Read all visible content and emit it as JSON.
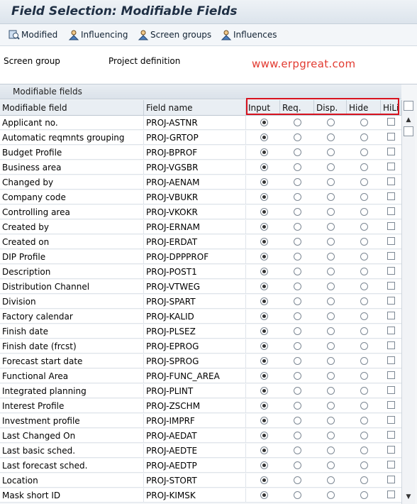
{
  "title": "Field Selection: Modifiable Fields",
  "toolbar": {
    "modified": "Modified",
    "influencing": "Influencing",
    "screen_groups": "Screen groups",
    "influences": "Influences"
  },
  "info": {
    "screen_group_label": "Screen group",
    "screen_group_value": "Project definition",
    "watermark": "www.erpgreat.com"
  },
  "grid": {
    "title": "Modifiable fields",
    "columns": {
      "modifiable_field": "Modifiable field",
      "field_name": "Field name",
      "input": "Input",
      "req": "Req.",
      "disp": "Disp.",
      "hide": "Hide",
      "hili": "HiLi"
    },
    "rows": [
      {
        "field": "Applicant no.",
        "name": "PROJ-ASTNR",
        "selected": "Input",
        "hili": false
      },
      {
        "field": "Automatic reqmnts grouping",
        "name": "PROJ-GRTOP",
        "selected": "Input",
        "hili": false
      },
      {
        "field": "Budget Profile",
        "name": "PROJ-BPROF",
        "selected": "Input",
        "hili": false
      },
      {
        "field": "Business area",
        "name": "PROJ-VGSBR",
        "selected": "Input",
        "hili": false
      },
      {
        "field": "Changed by",
        "name": "PROJ-AENAM",
        "selected": "Input",
        "hili": false
      },
      {
        "field": "Company code",
        "name": "PROJ-VBUKR",
        "selected": "Input",
        "hili": false
      },
      {
        "field": "Controlling area",
        "name": "PROJ-VKOKR",
        "selected": "Input",
        "hili": false
      },
      {
        "field": "Created by",
        "name": "PROJ-ERNAM",
        "selected": "Input",
        "hili": false
      },
      {
        "field": "Created on",
        "name": "PROJ-ERDAT",
        "selected": "Input",
        "hili": false
      },
      {
        "field": "DIP Profile",
        "name": "PROJ-DPPPROF",
        "selected": "Input",
        "hili": false
      },
      {
        "field": "Description",
        "name": "PROJ-POST1",
        "selected": "Input",
        "hili": false
      },
      {
        "field": "Distribution Channel",
        "name": "PROJ-VTWEG",
        "selected": "Input",
        "hili": false
      },
      {
        "field": "Division",
        "name": "PROJ-SPART",
        "selected": "Input",
        "hili": false
      },
      {
        "field": "Factory calendar",
        "name": "PROJ-KALID",
        "selected": "Input",
        "hili": false
      },
      {
        "field": "Finish date",
        "name": "PROJ-PLSEZ",
        "selected": "Input",
        "hili": false
      },
      {
        "field": "Finish date (frcst)",
        "name": "PROJ-EPROG",
        "selected": "Input",
        "hili": false
      },
      {
        "field": "Forecast start date",
        "name": "PROJ-SPROG",
        "selected": "Input",
        "hili": false
      },
      {
        "field": "Functional Area",
        "name": "PROJ-FUNC_AREA",
        "selected": "Input",
        "hili": false
      },
      {
        "field": "Integrated planning",
        "name": "PROJ-PLINT",
        "selected": "Input",
        "hili": false
      },
      {
        "field": "Interest Profile",
        "name": "PROJ-ZSCHM",
        "selected": "Input",
        "hili": false
      },
      {
        "field": "Investment profile",
        "name": "PROJ-IMPRF",
        "selected": "Input",
        "hili": false
      },
      {
        "field": "Last Changed On",
        "name": "PROJ-AEDAT",
        "selected": "Input",
        "hili": false
      },
      {
        "field": "Last basic sched.",
        "name": "PROJ-AEDTE",
        "selected": "Input",
        "hili": false
      },
      {
        "field": "Last forecast sched.",
        "name": "PROJ-AEDTP",
        "selected": "Input",
        "hili": false
      },
      {
        "field": "Location",
        "name": "PROJ-STORT",
        "selected": "Input",
        "hili": false
      },
      {
        "field": "Mask short ID",
        "name": "PROJ-KIMSK",
        "selected": "Input",
        "hili": false
      }
    ]
  }
}
